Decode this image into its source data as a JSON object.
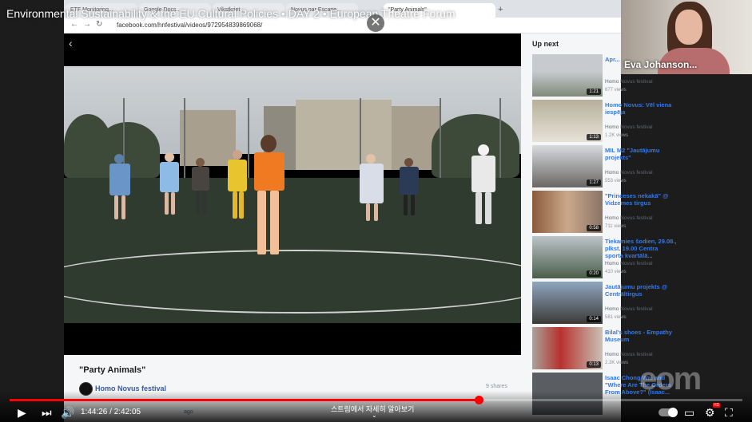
{
  "youtube": {
    "title": "Environmental Sustainability & the EU Cultural Policies • DAY 2 • European Theatre Forum",
    "time": "1:44:26 / 2:42:05",
    "korean_notice": "스트림에서 자세히 알아보기",
    "progress_fraction": 0.64
  },
  "browser": {
    "tabs": [
      {
        "label": "ETF Monitoring..."
      },
      {
        "label": "Google Docs..."
      },
      {
        "label": "Vikstkriet..."
      },
      {
        "label": "Novus par Escape..."
      },
      {
        "label": "\"Party Animals\""
      }
    ],
    "url": "facebook.com/hnfestival/videos/972954839869068/"
  },
  "facebook": {
    "video_title": "\"Party Animals\"",
    "page_name": "Homo Novus festival",
    "shares": "9 shares",
    "posted": "ago"
  },
  "up_next": {
    "title": "Up next",
    "items": [
      {
        "title": "Apr... dala... \"Svi...",
        "channel": "Homo Novus festival",
        "views": "677 views",
        "duration": "1:21"
      },
      {
        "title": "Homo Novus: Vēl viena iespēja",
        "channel": "Homo Novus festival",
        "views": "1.2K views",
        "duration": "1:13"
      },
      {
        "title": "MIL M2 \"Jautājumu projekts\"",
        "channel": "Homo Novus festival",
        "views": "553 views",
        "duration": "1:27"
      },
      {
        "title": "\"Princeses nekakā\" @ Vidzemes tirgus",
        "channel": "Homo Novus festival",
        "views": "711 views",
        "duration": "0:58"
      },
      {
        "title": "Tiekamies šodien, 29.08., plkst. 19.00 Centra sporta kvartālā...",
        "channel": "Homo Novus festival",
        "views": "410 views",
        "duration": "0:20"
      },
      {
        "title": "Jautājumu projekts @ Centrāltirgus",
        "channel": "Homo Novus festival",
        "views": "581 views",
        "duration": "0:14"
      },
      {
        "title": "Bilal's shoes - Empathy Museum",
        "channel": "Homo Novus festival",
        "views": "2.3K views",
        "duration": "0:13"
      },
      {
        "title": "Isaac Chong Wai and \"Where Are The Orders From Above?\" (Isaac...",
        "channel": "Homo Novus festival",
        "views": "",
        "duration": ""
      }
    ]
  },
  "webcam": {
    "name": "Eva Johanson..."
  },
  "watermark": "eom",
  "icons": {
    "play": "▶",
    "next": "⏭",
    "volume": "🔊",
    "share": "➦",
    "close": "✕",
    "back": "‹",
    "subtitles": "▭",
    "settings": "⚙",
    "fullscreen": "⛶"
  }
}
